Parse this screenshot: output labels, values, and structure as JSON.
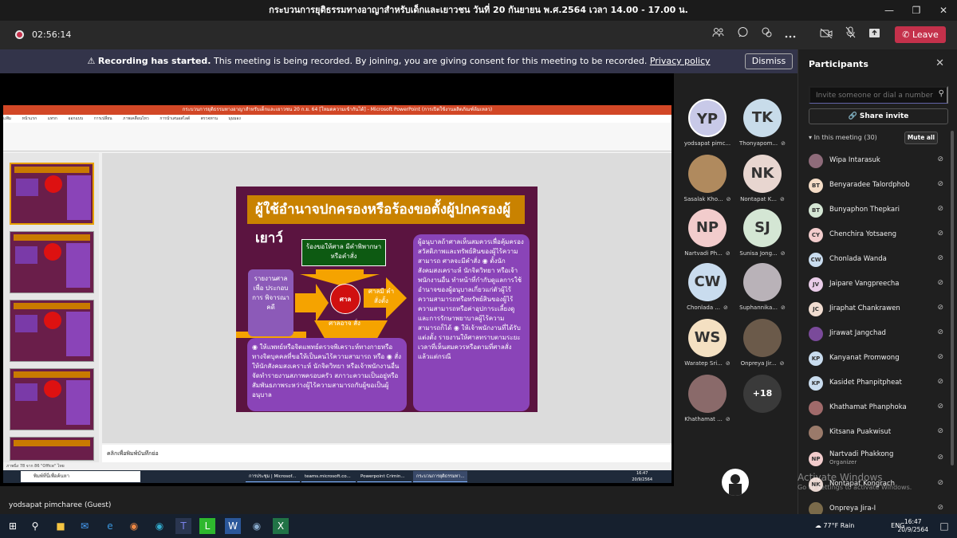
{
  "window": {
    "title": "กระบวนการยุติธรรมทางอาญาสำหรับเด็กและเยาวชน วันที่ 20 กันยายน พ.ศ.2564 เวลา 14.00 - 17.00 น.",
    "controls": [
      "—",
      "❐",
      "✕"
    ]
  },
  "toolbar": {
    "timer": "02:56:14",
    "leave_label": "Leave",
    "icons": [
      "people-icon",
      "chat-icon",
      "reactions-icon",
      "more-icon",
      "camera-off-icon",
      "mic-off-icon",
      "share-icon"
    ]
  },
  "banner": {
    "warn": "Recording has started.",
    "text": "This meeting is being recorded. By joining, you are giving consent for this meeting to be recorded.",
    "link": "Privacy policy",
    "dismiss": "Dismiss"
  },
  "shared": {
    "ppt_title": "กระบวนการยุติธรรมทางอาญาสำหรับเด็กและเยาวชน 20 ก.ย. 64 [โหมดความเข้ากันได้] - Microsoft PowerPoint (การเปิดใช้งานผลิตภัณฑ์ล้มเหลว)",
    "ribbon_tabs": [
      "แฟ้ม",
      "หน้าแรก",
      "แทรก",
      "ออกแบบ",
      "การเปลี่ยน",
      "ภาพเคลื่อนไหว",
      "การนำเสนอสไลด์",
      "ตรวจทาน",
      "มุมมอง"
    ],
    "notes": "คลิกเพื่อพิมพ์บันทึกย่อ",
    "status": "ภาพนิ่ง 78 จาก 86   \"Office\"   ไทย",
    "search": "พิมพ์ที่นี่เพื่อค้นหา",
    "taskbar_items": [
      "การประชุม | Microsof...",
      "teams.microsoft.co...",
      "Powerpoint Crimin...",
      "กระบวนการยุติธรรมทา..."
    ],
    "clock_time": "16:47",
    "clock_date": "20/9/2564"
  },
  "slide": {
    "title": "ผู้ใช้อำนาจปกครองหรือร้องขอตั้งผู้ปกครองผู้เยาว์",
    "court_request": "ร้องขอให้ศาล มีคำพิพากษาหรือคำสั่ง",
    "report": "รายงานศาล เพื่อ ประกอบการ พิจารณาคดี",
    "court": "ศาล",
    "order": "ศาลมี คำสั่งตั้ง",
    "may": "ศาลอาจ สั่ง",
    "right_text": "ผู้อนุบาลถ้าศาลเห็นสมควรเพื่อคุ้มครองสวัสดิภาพและทรัพย์สินของผู้ไร้ความสามารถ ศาลจะมีคำสั่ง ◉ ตั้งนักสังคมสงเคราะห์ นักจิตวิทยา หรือเจ้าพนักงานอื่น ทำหน้าที่กำกับดูแลการใช้อำนาจของผู้อนุบาลเกี่ยวแก่ตัวผู้ไร้ความสามารถหรือทรัพย์สินของผู้ไร้ความสามารถหรือค่าอุปการะเลี้ยงดูและการรักษาพยาบาลผู้ไร้ความสามารถก็ได้ ◉ ให้เจ้าพนักงานที่ได้รับแต่งตั้ง รายงานให้ศาลทราบตามระยะเวลาที่เห็นสมควรหรือตามที่ศาลสั่ง แล้วแต่กรณี",
    "bottom_text": "◉ ให้แพทย์หรือจิตแพทย์ตรวจพิเคราะห์ทางกายหรือทางจิตบุคคลที่ขอให้เป็นคนไร้ความสามารถ หรือ ◉ สั่งให้นักสังคมสงเคราะห์ นักจิตวิทยา หรือเจ้าพนักงานอื่นจัดทำรายงานสภาพครอบครัว สภาวะความเป็นอยู่หรือสัมพันธภาพระหว่างผู้ไร้ความสามารถกับผู้ขอเป็นผู้อนุบาล"
  },
  "tiles": [
    {
      "initials": "YP",
      "name": "yodsapat pimc...",
      "color": "#c8c9e8",
      "photo": false
    },
    {
      "initials": "TK",
      "name": "Thonyapom...",
      "color": "#c8dcea",
      "photo": false
    },
    {
      "initials": "",
      "name": "Sasalak Kho...",
      "color": "#b08a5e",
      "photo": true
    },
    {
      "initials": "NK",
      "name": "Nontapat K...",
      "color": "#e8d6d0",
      "photo": false
    },
    {
      "initials": "NP",
      "name": "Nartvadi Ph...",
      "color": "#f2cccc",
      "photo": false
    },
    {
      "initials": "SJ",
      "name": "Sunisa Jong...",
      "color": "#d4e6d4",
      "photo": false
    },
    {
      "initials": "CW",
      "name": "Chonlada ...",
      "color": "#c9dcee",
      "photo": false
    },
    {
      "initials": "",
      "name": "Suphannika...",
      "color": "#b9b2b8",
      "photo": true
    },
    {
      "initials": "WS",
      "name": "Waratep Sri...",
      "color": "#f4e0c2",
      "photo": false
    },
    {
      "initials": "",
      "name": "Onpreya Jir...",
      "color": "#6b5a4a",
      "photo": true
    },
    {
      "initials": "",
      "name": "Khathamat ...",
      "color": "#8a6a6a",
      "photo": true
    },
    {
      "initials": "+18",
      "name": "",
      "color": "#3a3a3a",
      "photo": false
    }
  ],
  "self": {
    "name": "yodsapat pimcharee (Guest)"
  },
  "panel": {
    "title": "Participants",
    "invite_placeholder": "Invite someone or dial a number",
    "share_invite": "Share invite",
    "in_meeting": "In this meeting (30)",
    "mute_all": "Mute all",
    "people": [
      {
        "initials": "",
        "name": "Wipa Intarasuk",
        "color": "#8e6b7a",
        "role": ""
      },
      {
        "initials": "BT",
        "name": "Benyaradee Talordphob",
        "color": "#f4dcc6",
        "role": ""
      },
      {
        "initials": "BT",
        "name": "Bunyaphon Thepkari",
        "color": "#d4e6d4",
        "role": ""
      },
      {
        "initials": "CY",
        "name": "Chenchira Yotsaeng",
        "color": "#f2cccc",
        "role": ""
      },
      {
        "initials": "CW",
        "name": "Chonlada Wanda",
        "color": "#c9dcee",
        "role": ""
      },
      {
        "initials": "JV",
        "name": "Jaipare Vangpreecha",
        "color": "#e9cce8",
        "role": ""
      },
      {
        "initials": "JC",
        "name": "Jiraphat Chankrawen",
        "color": "#f0dcd0",
        "role": ""
      },
      {
        "initials": "",
        "name": "Jirawat Jangchad",
        "color": "#7a4a9a",
        "role": ""
      },
      {
        "initials": "KP",
        "name": "Kanyanat Promwong",
        "color": "#c9dcee",
        "role": ""
      },
      {
        "initials": "KP",
        "name": "Kasidet Phanpitpheat",
        "color": "#c9dcee",
        "role": ""
      },
      {
        "initials": "",
        "name": "Khathamat Phanphoka",
        "color": "#a06a6a",
        "role": ""
      },
      {
        "initials": "",
        "name": "Kitsana Puakwisut",
        "color": "#9a7a6a",
        "role": ""
      },
      {
        "initials": "NP",
        "name": "Nartvadi Phakkong",
        "color": "#f2cccc",
        "role": "Organizer"
      },
      {
        "initials": "NK",
        "name": "Nontapat Kongrach",
        "color": "#e8d6d0",
        "role": ""
      },
      {
        "initials": "",
        "name": "Onpreya Jira-I",
        "color": "#7a6a4a",
        "role": ""
      }
    ]
  },
  "watermark": {
    "line1": "Activate Windows",
    "line2": "Go to Settings to activate Windows."
  },
  "wtaskbar": {
    "weather": "77°F  Rain",
    "lang": "ENG",
    "time": "16:47",
    "date": "20/9/2564"
  }
}
